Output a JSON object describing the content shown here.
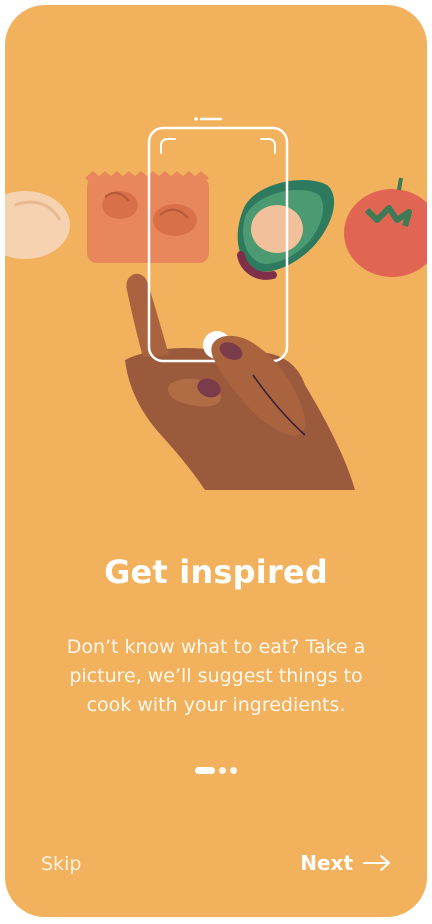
{
  "onboarding": {
    "title": "Get inspired",
    "description": "Don’t know what to eat? Take a picture, we’ll suggest things to cook with your ingredients.",
    "pagination": {
      "total": 3,
      "current": 1
    },
    "skip_label": "Skip",
    "next_label": "Next",
    "next_icon": "arrow-right-icon"
  },
  "colors": {
    "background": "#F2B15D",
    "text": "#FFFFFF"
  }
}
